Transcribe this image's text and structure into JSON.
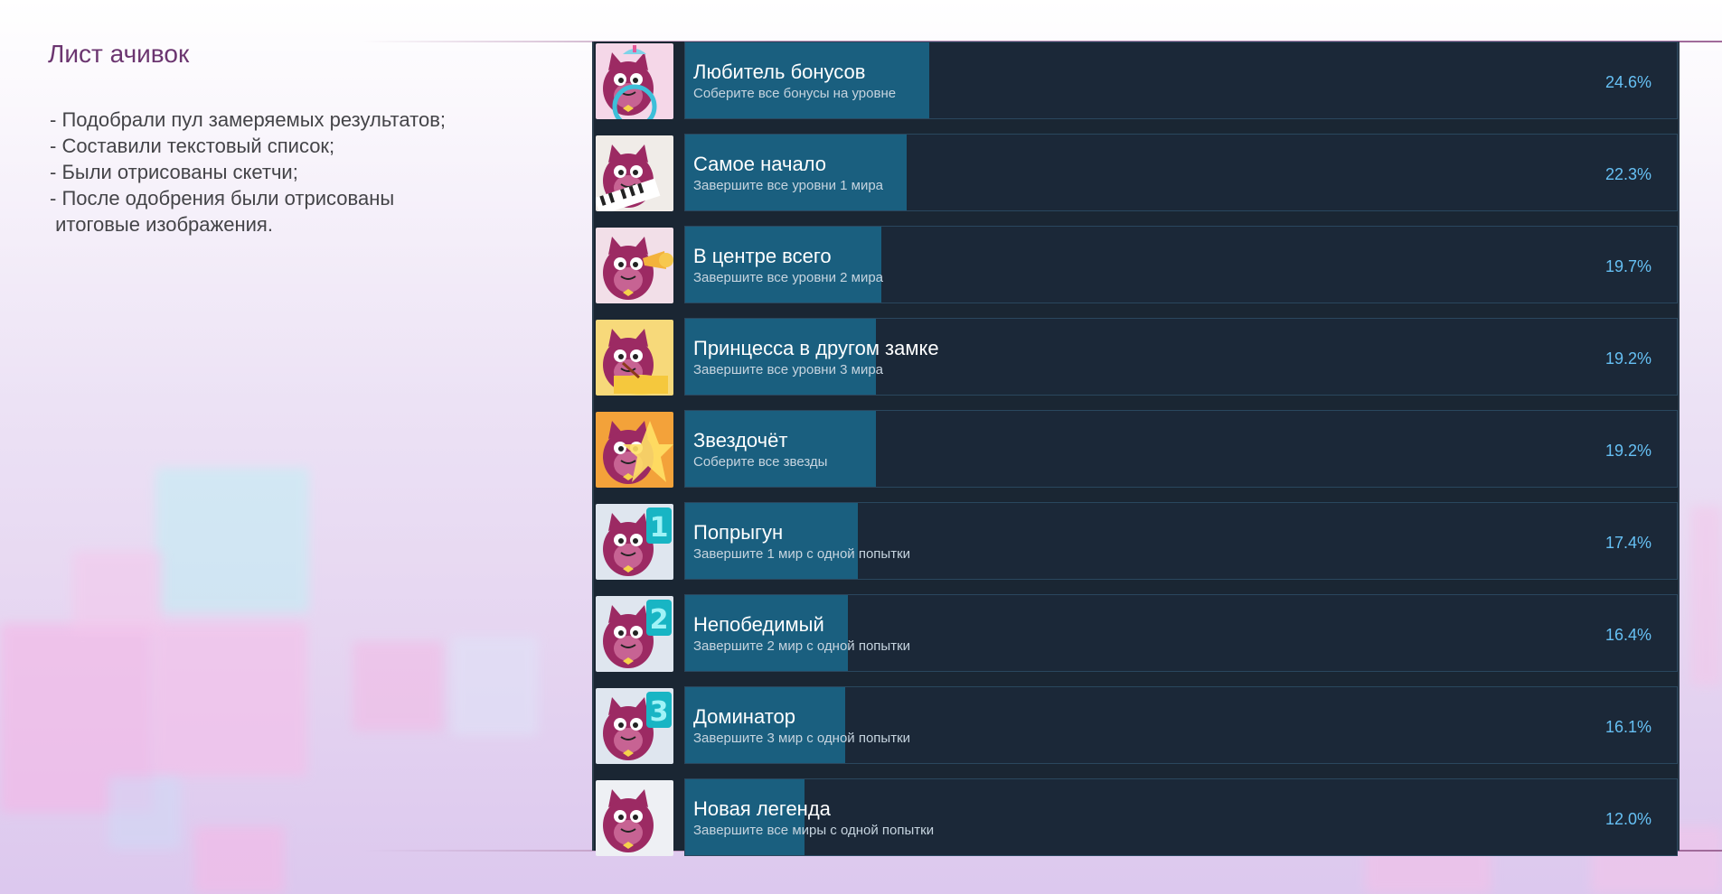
{
  "page": {
    "title": "Лист ачивок",
    "notes": [
      "- Подобрали пул замеряемых результатов;",
      "- Составили текстовый список;",
      "- Были отрисованы скетчи;",
      "- После одобрения были отрисованы",
      " итоговые изображения."
    ]
  },
  "colors": {
    "panel_bg": "#1b2838",
    "progress_fill": "#1a5f7f",
    "percent_text": "#66c0f4",
    "character": "#9c2a63",
    "title_text": "#6b3570"
  },
  "achievements": [
    {
      "name": "Любитель бонусов",
      "description": "Соберите все бонусы на уровне",
      "percent": "24.6%",
      "value": 24.6,
      "icon": "cat-with-propeller-cap-icon"
    },
    {
      "name": "Самое начало",
      "description": "Завершите все уровни 1 мира",
      "percent": "22.3%",
      "value": 22.3,
      "icon": "cat-with-piano-icon"
    },
    {
      "name": "В центре всего",
      "description": "Завершите все уровни 2 мира",
      "percent": "19.7%",
      "value": 19.7,
      "icon": "cat-with-trumpet-icon"
    },
    {
      "name": "Принцесса в другом замке",
      "description": "Завершите все уровни 3 мира",
      "percent": "19.2%",
      "value": 19.2,
      "icon": "cat-with-drum-icon"
    },
    {
      "name": "Звездочёт",
      "description": "Соберите все звезды",
      "percent": "19.2%",
      "value": 19.2,
      "icon": "cat-with-star-icon"
    },
    {
      "name": "Попрыгун",
      "description": "Завершите 1 мир с одной попытки",
      "percent": "17.4%",
      "value": 17.4,
      "icon": "cat-world-1-icon",
      "badge": "1"
    },
    {
      "name": "Непобедимый",
      "description": "Завершите 2 мир с одной попытки",
      "percent": "16.4%",
      "value": 16.4,
      "icon": "cat-world-2-icon",
      "badge": "2"
    },
    {
      "name": "Доминатор",
      "description": "Завершите 3 мир с одной попытки",
      "percent": "16.1%",
      "value": 16.1,
      "icon": "cat-world-3-icon",
      "badge": "3"
    },
    {
      "name": "Новая легенда",
      "description": "Завершите все миры с одной попытки",
      "percent": "12.0%",
      "value": 12.0,
      "icon": "surprised-cat-icon"
    }
  ]
}
